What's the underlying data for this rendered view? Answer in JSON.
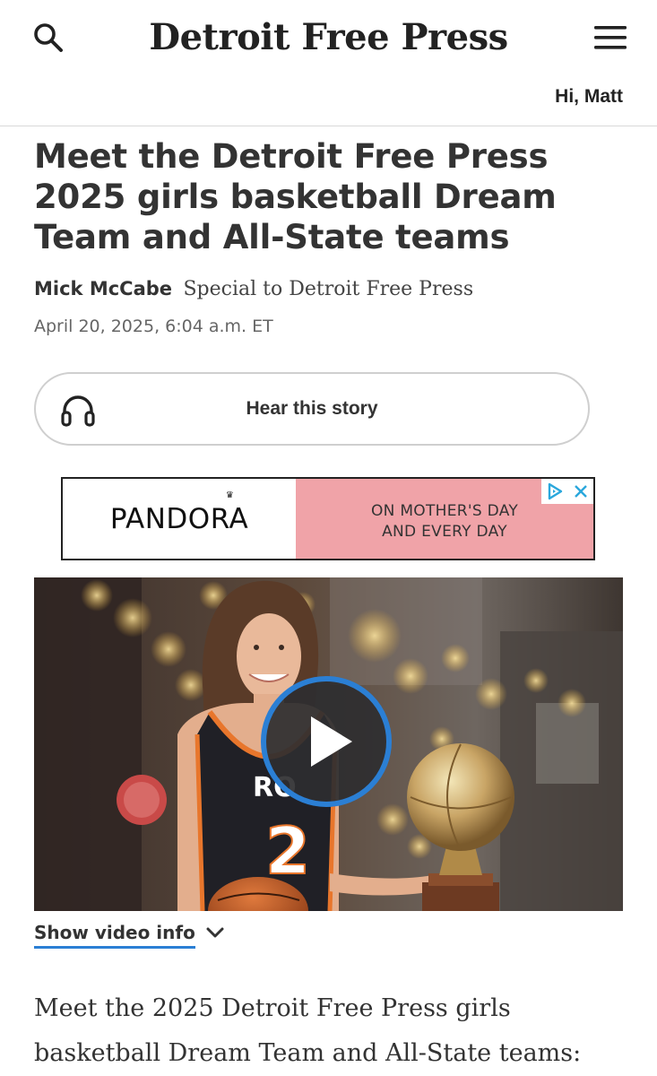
{
  "header": {
    "logo_text": "Detroit Free Press",
    "greeting": "Hi, Matt",
    "search_icon": "search-icon",
    "menu_icon": "hamburger-menu-icon"
  },
  "article": {
    "headline": "Meet the Detroit Free Press 2025 girls basketball Dream Team and All-State teams",
    "author": "Mick McCabe",
    "affiliation": "Special to Detroit Free Press",
    "timestamp": "April 20, 2025, 6:04 a.m. ET",
    "body_first_line": "Meet the 2025 Detroit Free Press girls basketball Dream Team and All-State teams:"
  },
  "audio": {
    "label": "Hear this story",
    "icon": "headphones-icon"
  },
  "ad": {
    "brand": "PANDORA",
    "tagline": "ON MOTHER'S DAY\nAND EVERY DAY",
    "background_color": "#f0a3a8",
    "adchoices_icon": "adchoices-icon",
    "close_icon": "close-icon"
  },
  "video": {
    "play_icon": "play-icon",
    "jersey_number": "2",
    "show_info_label": "Show video info",
    "chevron_icon": "chevron-down-icon",
    "accent_color": "#2b7fd4"
  }
}
